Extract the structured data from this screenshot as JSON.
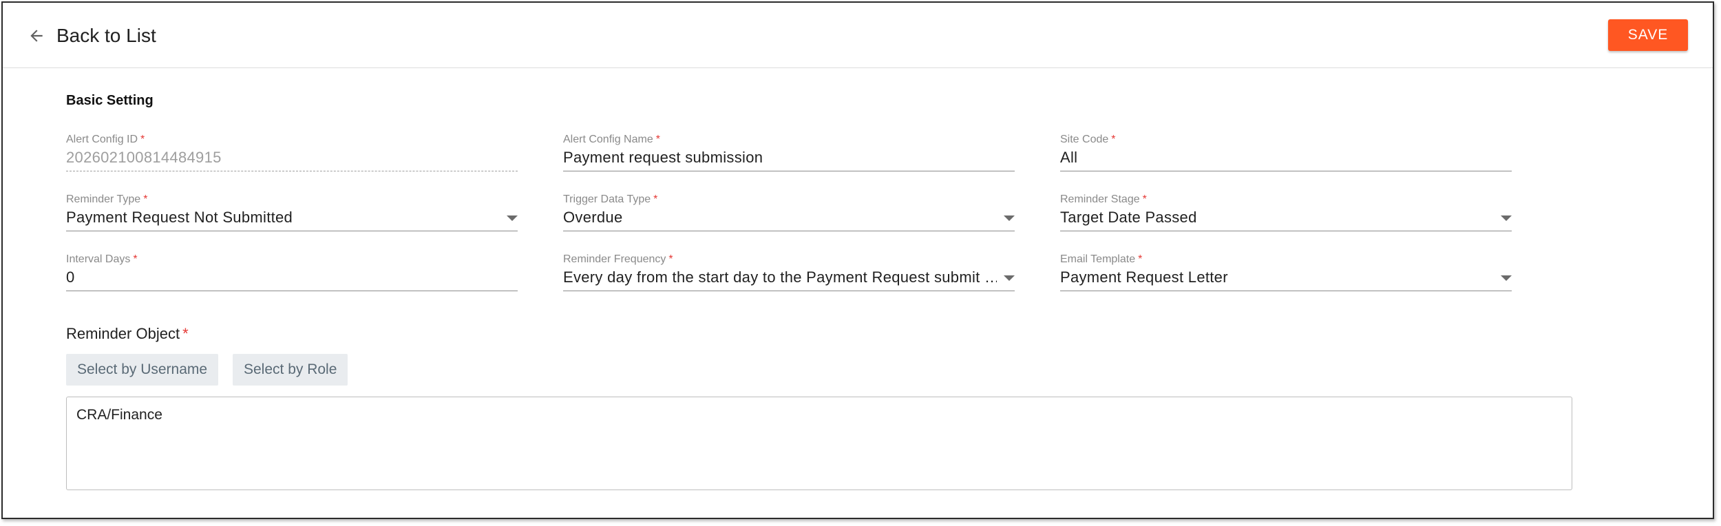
{
  "header": {
    "back_label": "Back to List",
    "save_label": "SAVE"
  },
  "section": {
    "title": "Basic Setting"
  },
  "fields": {
    "alert_config_id": {
      "label": "Alert Config ID",
      "value": "202602100814484915"
    },
    "alert_config_name": {
      "label": "Alert Config Name",
      "value": "Payment request submission"
    },
    "site_code": {
      "label": "Site Code",
      "value": "All"
    },
    "reminder_type": {
      "label": "Reminder Type",
      "value": "Payment Request Not Submitted"
    },
    "trigger_data_type": {
      "label": "Trigger Data Type",
      "value": "Overdue"
    },
    "reminder_stage": {
      "label": "Reminder Stage",
      "value": "Target Date Passed"
    },
    "interval_days": {
      "label": "Interval Days",
      "value": "0"
    },
    "reminder_frequency": {
      "label": "Reminder Frequency",
      "value": "Every day from the start day to the Payment Request submit …"
    },
    "email_template": {
      "label": "Email Template",
      "value": "Payment Request Letter"
    }
  },
  "reminder_object": {
    "label": "Reminder Object",
    "select_by_username": "Select by Username",
    "select_by_role": "Select by Role",
    "value": "CRA/Finance"
  },
  "required_mark": "*",
  "colors": {
    "accent": "#ff5722",
    "required": "#e53935"
  },
  "icons": {
    "back": "arrow-left-icon",
    "dropdown": "caret-down-icon"
  }
}
